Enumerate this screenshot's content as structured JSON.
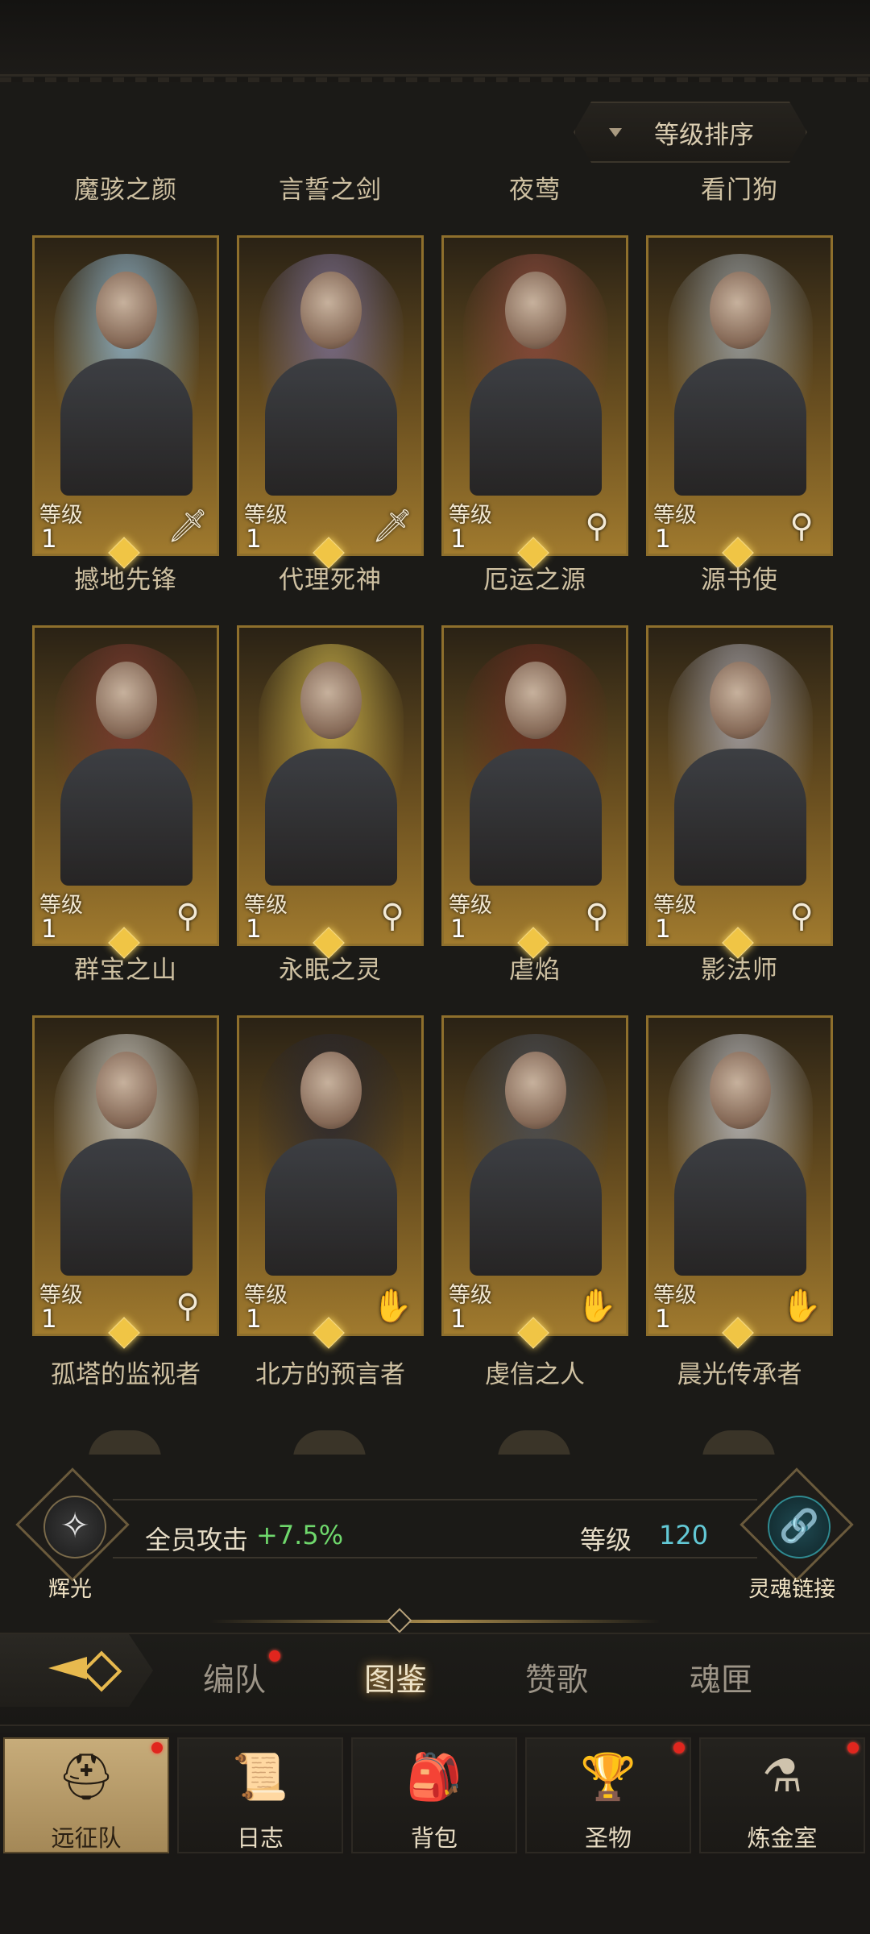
{
  "sort_button": {
    "label": "等级排序"
  },
  "level_label": "等级",
  "heroes": [
    {
      "name": "魔骇之颜",
      "level": "1",
      "role": "sword-icon",
      "glyph": "🗡",
      "tint": "#8fb3c9"
    },
    {
      "name": "言誓之剑",
      "level": "1",
      "role": "sword-icon",
      "glyph": "🗡",
      "tint": "#7a6e8f"
    },
    {
      "name": "夜莺",
      "level": "1",
      "role": "staff-icon",
      "glyph": "⚲",
      "tint": "#8a4a3e"
    },
    {
      "name": "看门狗",
      "level": "1",
      "role": "staff-icon",
      "glyph": "⚲",
      "tint": "#9aa0a3"
    },
    {
      "name": "撼地先锋",
      "level": "1",
      "role": "staff-icon",
      "glyph": "⚲",
      "tint": "#7a3a30"
    },
    {
      "name": "代理死神",
      "level": "1",
      "role": "staff-icon",
      "glyph": "⚲",
      "tint": "#c9b04a"
    },
    {
      "name": "厄运之源",
      "level": "1",
      "role": "staff-icon",
      "glyph": "⚲",
      "tint": "#6b2e22"
    },
    {
      "name": "源书使",
      "level": "1",
      "role": "staff-icon",
      "glyph": "⚲",
      "tint": "#a5a2a8"
    },
    {
      "name": "群宝之山",
      "level": "1",
      "role": "staff-icon",
      "glyph": "⚲",
      "tint": "#c8c6bf"
    },
    {
      "name": "永眠之灵",
      "level": "1",
      "role": "hand-icon",
      "glyph": "✋",
      "tint": "#2d2a30"
    },
    {
      "name": "虐焰",
      "level": "1",
      "role": "hand-icon",
      "glyph": "✋",
      "tint": "#4c4f56"
    },
    {
      "name": "影法师",
      "level": "1",
      "role": "hand-icon",
      "glyph": "✋",
      "tint": "#b7b8bc"
    }
  ],
  "next_row": [
    "孤塔的监视者",
    "北方的预言者",
    "虔信之人",
    "晨光传承者"
  ],
  "bonus": {
    "radiance_label": "辉光",
    "attack_label": "全员攻击",
    "attack_value": "+7.5%",
    "level_label": "等级",
    "level_value": "120",
    "soul_link_label": "灵魂链接"
  },
  "sub_tabs": [
    {
      "label": "编队",
      "active": false,
      "badge": true
    },
    {
      "label": "图鉴",
      "active": true,
      "badge": false
    },
    {
      "label": "赞歌",
      "active": false,
      "badge": false
    },
    {
      "label": "魂匣",
      "active": false,
      "badge": false
    }
  ],
  "bottom_nav": [
    {
      "label": "远征队",
      "icon": "horned-helmet-icon",
      "glyph": "⛑",
      "active": true,
      "badge": true
    },
    {
      "label": "日志",
      "icon": "scroll-map-icon",
      "glyph": "📜",
      "active": false,
      "badge": false
    },
    {
      "label": "背包",
      "icon": "backpack-icon",
      "glyph": "🎒",
      "active": false,
      "badge": false
    },
    {
      "label": "圣物",
      "icon": "chalice-icon",
      "glyph": "🏆",
      "active": false,
      "badge": true
    },
    {
      "label": "炼金室",
      "icon": "alchemy-icon",
      "glyph": "⚗",
      "active": false,
      "badge": true
    }
  ],
  "colors": {
    "accent_gold": "#f0c545",
    "attack_green": "#6fd86c",
    "level_cyan": "#63c9d6",
    "badge_red": "#e0261e"
  }
}
